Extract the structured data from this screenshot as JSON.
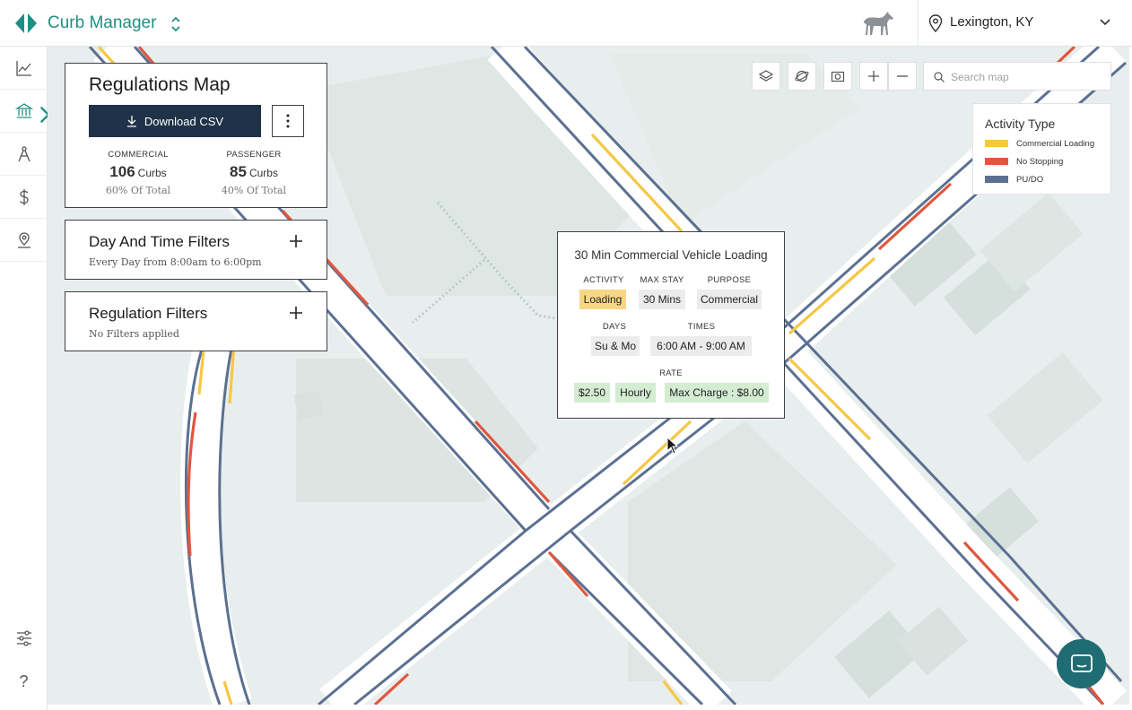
{
  "header": {
    "app_name": "Curb Manager",
    "location": "Lexington, KY",
    "icons": {
      "logo": "diamond-arrows-logo",
      "switcher": "chevron-up-down-icon",
      "horse": "horse-logo",
      "pin": "map-pin-icon",
      "chevron": "chevron-down-icon"
    }
  },
  "sidebar": {
    "items": [
      {
        "name": "analytics",
        "icon": "line-chart-icon"
      },
      {
        "name": "regulations",
        "icon": "bank-icon",
        "active": true
      },
      {
        "name": "planning",
        "icon": "compass-icon"
      },
      {
        "name": "pricing",
        "icon": "dollar-icon"
      },
      {
        "name": "locations",
        "icon": "location-icon"
      },
      {
        "name": "settings",
        "icon": "sliders-icon"
      },
      {
        "name": "help",
        "icon": "question-icon"
      }
    ],
    "help_glyph": "?",
    "active_color": "#1f8f83"
  },
  "regulations_panel": {
    "title": "Regulations Map",
    "download_label": "Download CSV",
    "commercial": {
      "label": "COMMERCIAL",
      "count": "106",
      "unit": "Curbs",
      "pct": "60% Of Total"
    },
    "passenger": {
      "label": "PASSENGER",
      "count": "85",
      "unit": "Curbs",
      "pct": "40% Of Total"
    }
  },
  "day_time_filters": {
    "title": "Day And Time Filters",
    "subtitle": "Every Day from 8:00am to 6:00pm"
  },
  "regulation_filters": {
    "title": "Regulation Filters",
    "subtitle": "No Filters applied"
  },
  "map_tools": {
    "search_placeholder": "Search map",
    "icons": [
      "layers-icon",
      "globe-icon",
      "camera-icon",
      "zoom-in-icon",
      "zoom-out-icon",
      "search-icon"
    ]
  },
  "legend": {
    "title": "Activity Type",
    "items": [
      {
        "label": "Commercial Loading",
        "color": "#f6c745"
      },
      {
        "label": "No Stopping",
        "color": "#e0573f"
      },
      {
        "label": "PU/DO",
        "color": "#5b7091"
      }
    ]
  },
  "popup": {
    "title": "30 Min Commercial Vehicle Loading",
    "activity_label": "ACTIVITY",
    "activity": "Loading",
    "maxstay_label": "MAX STAY",
    "maxstay": "30 Mins",
    "purpose_label": "PURPOSE",
    "purpose": "Commercial",
    "days_label": "DAYS",
    "days": "Su & Mo",
    "times_label": "TIMES",
    "times": "6:00 AM - 9:00 AM",
    "rate_label": "RATE",
    "rate": "$2.50",
    "rate_unit": "Hourly",
    "max_charge": "Max Charge : $8.00"
  },
  "colors": {
    "brand": "#1f8f83",
    "button_dark": "#1f3247",
    "chat": "#1f6c74",
    "map_bg": "#e8eeed"
  }
}
